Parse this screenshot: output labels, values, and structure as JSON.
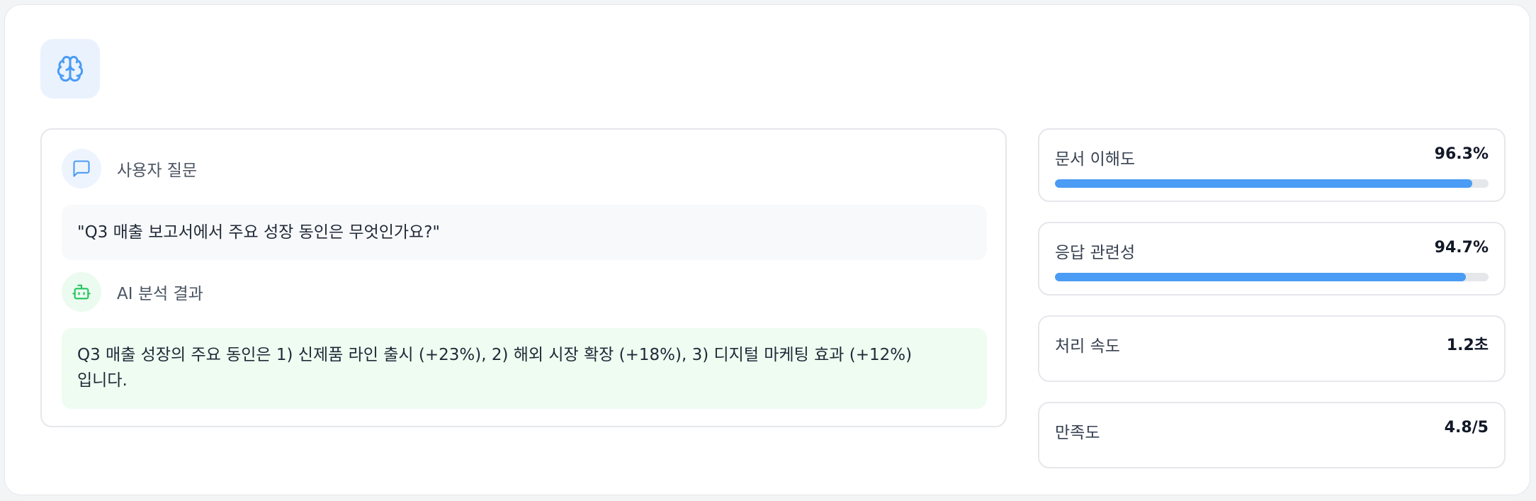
{
  "header": {
    "icon": "brain-icon"
  },
  "chat": {
    "user": {
      "icon": "message-square-icon",
      "label": "사용자 질문",
      "text": "\"Q3 매출 보고서에서 주요 성장 동인은 무엇인가요?\""
    },
    "ai": {
      "icon": "bot-icon",
      "label": "AI 분석 결과",
      "text": "Q3 매출 성장의 주요 동인은 1) 신제품 라인 출시 (+23%), 2) 해외 시장 확장 (+18%), 3) 디지털 마케팅 효과 (+12%) 입니다."
    }
  },
  "metrics": [
    {
      "label": "문서 이해도",
      "value": "96.3%",
      "progress": 0.963
    },
    {
      "label": "응답 관련성",
      "value": "94.7%",
      "progress": 0.947
    },
    {
      "label": "처리 속도",
      "value": "1.2초"
    },
    {
      "label": "만족도",
      "value": "4.8/5"
    }
  ],
  "colors": {
    "accent": "#4a9cf4",
    "user_bubble": "#f8f9fb",
    "ai_bubble": "#eefcf1",
    "user_icon": "#4a9cf4",
    "ai_icon": "#22c55e"
  }
}
